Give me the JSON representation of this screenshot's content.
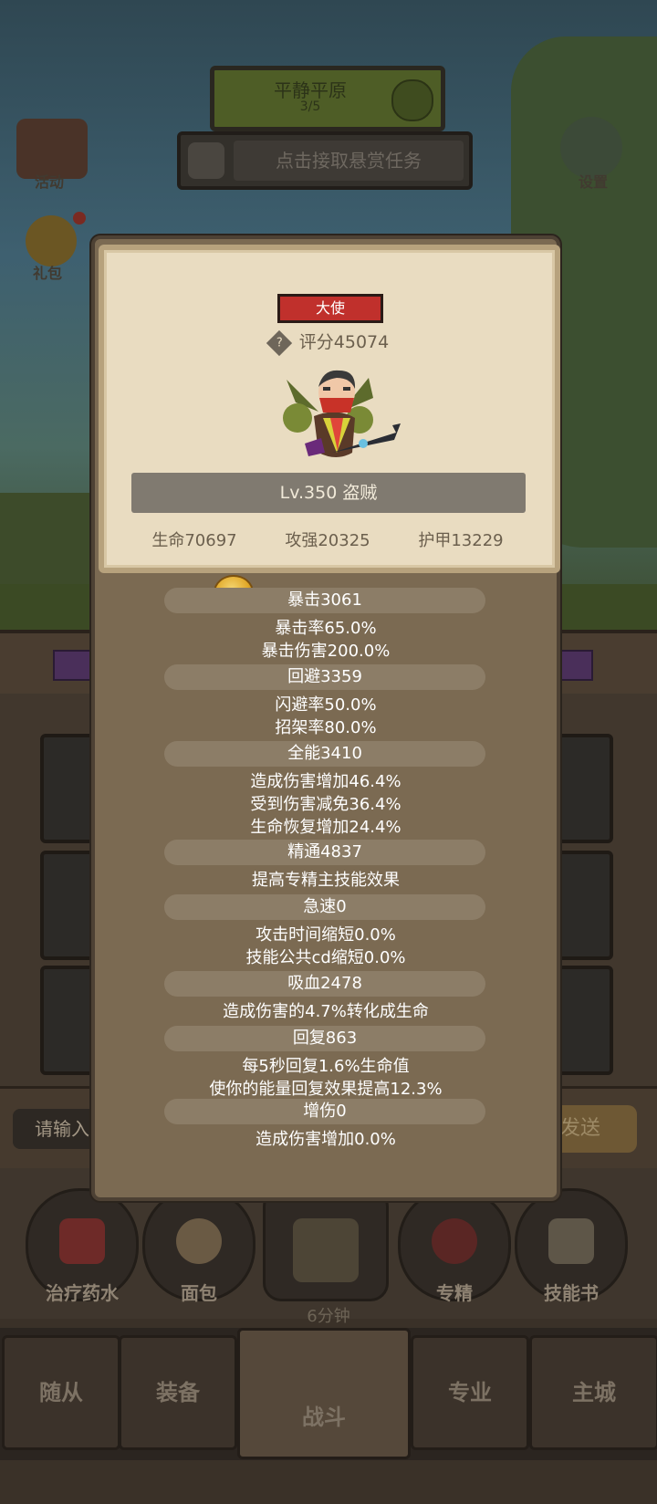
{
  "background": {
    "banner": {
      "title": "平静平原",
      "progress": "3/5"
    },
    "quest_button": "点击接取悬赏任务",
    "left_icons": [
      {
        "label": "活动"
      },
      {
        "label": "礼包"
      }
    ],
    "settings_label": "设置",
    "chat": {
      "input_placeholder": "请输入",
      "send_label": "发送"
    },
    "items": [
      "治疗药水",
      "面包",
      "",
      "专精",
      "技能书"
    ],
    "timer": "6分钟",
    "nav_tabs": [
      "随从",
      "装备",
      "战斗",
      "专业",
      "主城"
    ],
    "active_tab": "战斗"
  },
  "modal": {
    "rank": "大使",
    "score_prefix": "评分",
    "score": "45074",
    "score_text": "评分45074",
    "help_glyph": "?",
    "level_class": "Lv.350 盗贼",
    "stats": {
      "hp": "生命70697",
      "atk": "攻强20325",
      "armor": "护甲13229"
    },
    "attributes": [
      {
        "title": "暴击3061",
        "lines": [
          "暴击率65.0%",
          "暴击伤害200.0%"
        ]
      },
      {
        "title": "回避3359",
        "lines": [
          "闪避率50.0%",
          "招架率80.0%"
        ]
      },
      {
        "title": "全能3410",
        "lines": [
          "造成伤害增加46.4%",
          "受到伤害减免36.4%",
          "生命恢复增加24.4%"
        ]
      },
      {
        "title": "精通4837",
        "lines": [
          "提高专精主技能效果"
        ]
      },
      {
        "title": "急速0",
        "lines": [
          "攻击时间缩短0.0%",
          "技能公共cd缩短0.0%"
        ]
      },
      {
        "title": "吸血2478",
        "lines": [
          "造成伤害的4.7%转化成生命"
        ]
      },
      {
        "title": "回复863",
        "lines": [
          "每5秒回复1.6%生命值",
          "使你的能量回复效果提高12.3%"
        ]
      },
      {
        "title": "增伤0",
        "lines": [
          "造成伤害增加0.0%"
        ]
      }
    ]
  },
  "colors": {
    "rank_badge": "#c0302c",
    "card_bg": "#e9dcc1",
    "modal_bg": "#7b6a52",
    "pill_bg": "#8c7d67"
  }
}
